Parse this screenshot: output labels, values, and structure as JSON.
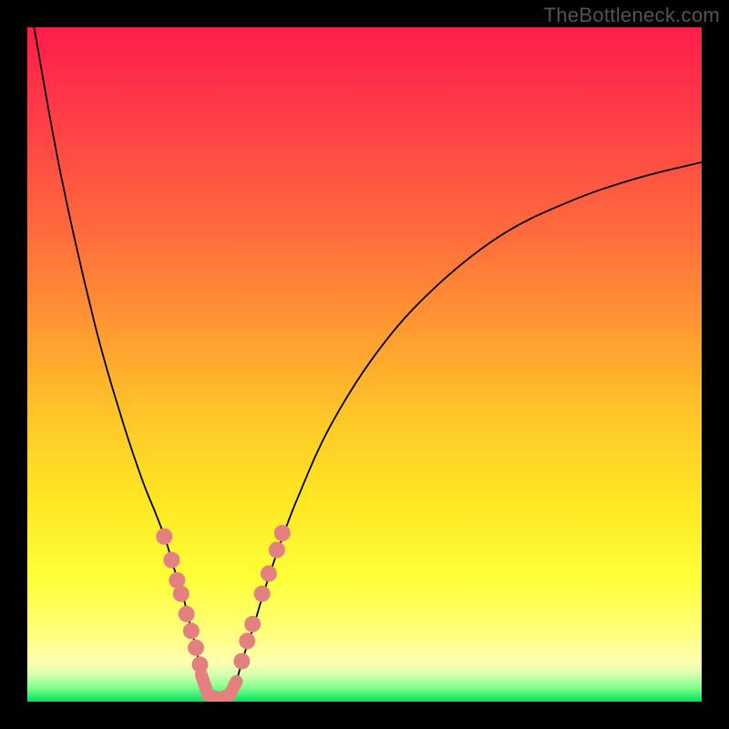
{
  "watermark": "TheBottleneck.com",
  "colors": {
    "frame": "#000000",
    "curve": "#000000",
    "marker": "#e58080",
    "gradient_stops": [
      "#ff1d4a",
      "#ff6a3d",
      "#ffc728",
      "#ffff3a",
      "#00e060"
    ]
  },
  "chart_data": {
    "type": "line",
    "title": "",
    "xlabel": "",
    "ylabel": "",
    "xlim": [
      0,
      1
    ],
    "ylim": [
      0,
      1
    ],
    "series": [
      {
        "name": "left-curve",
        "x": [
          0.01,
          0.05,
          0.1,
          0.14,
          0.17,
          0.19,
          0.205,
          0.22,
          0.23,
          0.24,
          0.25,
          0.255,
          0.26,
          0.265,
          0.27
        ],
        "y": [
          1.0,
          0.78,
          0.56,
          0.42,
          0.33,
          0.28,
          0.24,
          0.19,
          0.16,
          0.12,
          0.08,
          0.055,
          0.035,
          0.018,
          0.0
        ]
      },
      {
        "name": "right-curve",
        "x": [
          0.3,
          0.31,
          0.32,
          0.335,
          0.35,
          0.37,
          0.4,
          0.45,
          0.52,
          0.6,
          0.7,
          0.8,
          0.9,
          1.0
        ],
        "y": [
          0.0,
          0.03,
          0.065,
          0.11,
          0.16,
          0.22,
          0.3,
          0.41,
          0.52,
          0.61,
          0.69,
          0.74,
          0.775,
          0.8
        ]
      },
      {
        "name": "elbow",
        "x": [
          0.258,
          0.268,
          0.285,
          0.3,
          0.31
        ],
        "y": [
          0.04,
          0.01,
          0.005,
          0.01,
          0.03
        ]
      }
    ],
    "markers": {
      "left_dots": [
        {
          "x": 0.203,
          "y": 0.245
        },
        {
          "x": 0.214,
          "y": 0.21
        },
        {
          "x": 0.222,
          "y": 0.18
        },
        {
          "x": 0.228,
          "y": 0.16
        },
        {
          "x": 0.236,
          "y": 0.13
        },
        {
          "x": 0.243,
          "y": 0.105
        },
        {
          "x": 0.25,
          "y": 0.08
        },
        {
          "x": 0.256,
          "y": 0.055
        }
      ],
      "right_dots": [
        {
          "x": 0.318,
          "y": 0.06
        },
        {
          "x": 0.326,
          "y": 0.09
        },
        {
          "x": 0.334,
          "y": 0.115
        },
        {
          "x": 0.348,
          "y": 0.16
        },
        {
          "x": 0.358,
          "y": 0.19
        },
        {
          "x": 0.37,
          "y": 0.225
        },
        {
          "x": 0.378,
          "y": 0.25
        }
      ]
    }
  }
}
